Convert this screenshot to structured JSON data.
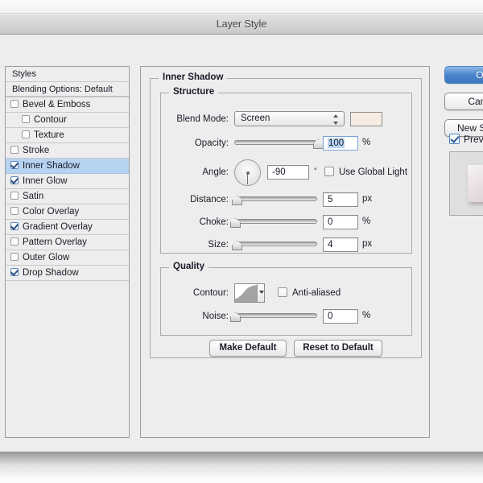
{
  "window": {
    "title": "Layer Style"
  },
  "styles_panel": {
    "header": "Styles",
    "blending_options": "Blending Options: Default",
    "effects": [
      {
        "label": "Bevel & Emboss",
        "checked": false,
        "indent": false,
        "selected": false
      },
      {
        "label": "Contour",
        "checked": false,
        "indent": true,
        "selected": false
      },
      {
        "label": "Texture",
        "checked": false,
        "indent": true,
        "selected": false
      },
      {
        "label": "Stroke",
        "checked": false,
        "indent": false,
        "selected": false
      },
      {
        "label": "Inner Shadow",
        "checked": true,
        "indent": false,
        "selected": true
      },
      {
        "label": "Inner Glow",
        "checked": true,
        "indent": false,
        "selected": false
      },
      {
        "label": "Satin",
        "checked": false,
        "indent": false,
        "selected": false
      },
      {
        "label": "Color Overlay",
        "checked": false,
        "indent": false,
        "selected": false
      },
      {
        "label": "Gradient Overlay",
        "checked": true,
        "indent": false,
        "selected": false
      },
      {
        "label": "Pattern Overlay",
        "checked": false,
        "indent": false,
        "selected": false
      },
      {
        "label": "Outer Glow",
        "checked": false,
        "indent": false,
        "selected": false
      },
      {
        "label": "Drop Shadow",
        "checked": true,
        "indent": false,
        "selected": false
      }
    ]
  },
  "panel": {
    "group_title": "Inner Shadow",
    "structure": {
      "title": "Structure",
      "blend_mode_label": "Blend Mode:",
      "blend_mode_value": "Screen",
      "blend_color": "#f7ece2",
      "opacity_label": "Opacity:",
      "opacity_value": "100",
      "opacity_unit": "%",
      "opacity_percent": 100,
      "angle_label": "Angle:",
      "angle_value": "-90",
      "angle_unit": "°",
      "angle_degrees": -90,
      "use_global_light": "Use Global Light",
      "use_global_light_checked": false,
      "distance_label": "Distance:",
      "distance_value": "5",
      "distance_unit": "px",
      "distance_percent": 2,
      "choke_label": "Choke:",
      "choke_value": "0",
      "choke_unit": "%",
      "choke_percent": 0,
      "size_label": "Size:",
      "size_value": "4",
      "size_unit": "px",
      "size_percent": 2
    },
    "quality": {
      "title": "Quality",
      "contour_label": "Contour:",
      "anti_aliased_label": "Anti-aliased",
      "anti_aliased_checked": false,
      "noise_label": "Noise:",
      "noise_value": "0",
      "noise_unit": "%",
      "noise_percent": 0
    },
    "buttons": {
      "make_default": "Make Default",
      "reset_to_default": "Reset to Default"
    }
  },
  "actions": {
    "ok": "OK",
    "cancel": "Cancel",
    "new_style": "New Style...",
    "preview": "Preview",
    "preview_checked": true,
    "accent": "#4a84ca"
  }
}
